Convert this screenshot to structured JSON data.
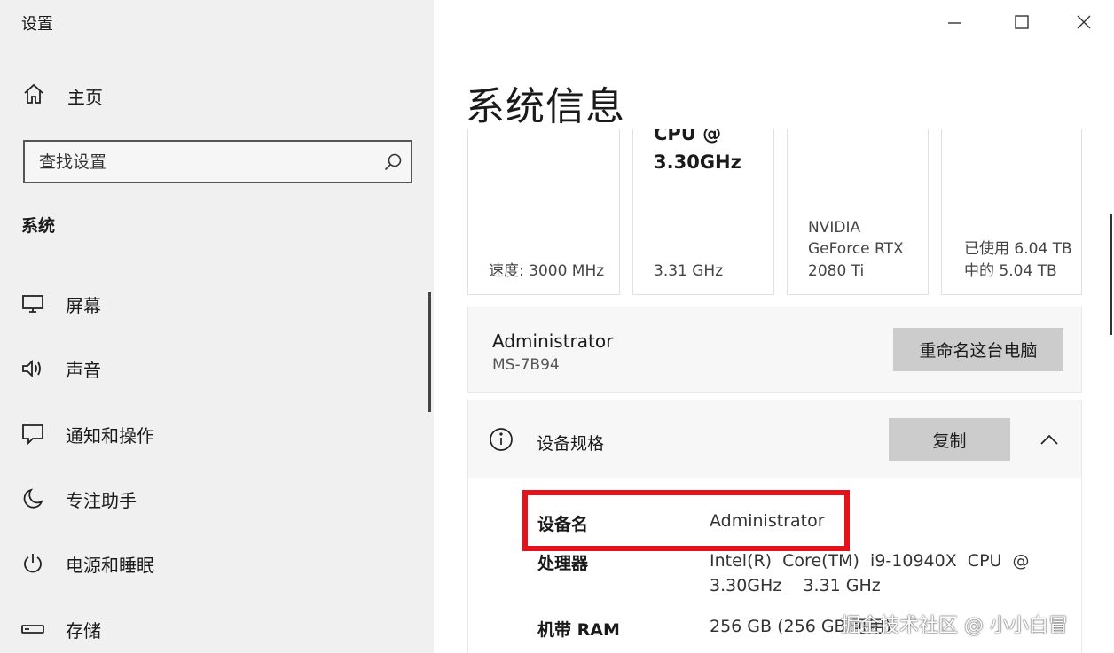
{
  "app": {
    "title": "设置"
  },
  "window_controls": {
    "minimize": "minimize-icon",
    "maximize": "maximize-icon",
    "close": "close-icon"
  },
  "sidebar": {
    "home_label": "主页",
    "search_placeholder": "查找设置",
    "section_title": "系统",
    "items": [
      {
        "label": "屏幕",
        "icon": "monitor-icon"
      },
      {
        "label": "声音",
        "icon": "speaker-icon"
      },
      {
        "label": "通知和操作",
        "icon": "notification-icon"
      },
      {
        "label": "专注助手",
        "icon": "moon-icon"
      },
      {
        "label": "电源和睡眠",
        "icon": "power-icon"
      },
      {
        "label": "存储",
        "icon": "storage-icon"
      }
    ]
  },
  "main": {
    "title": "系统信息",
    "cards": {
      "ram_speed": "速度: 3000 MHz",
      "cpu_name_tail": "CPU @",
      "cpu_name_tail2": "3.30GHz",
      "cpu_speed": "3.31 GHz",
      "gpu_line1": "NVIDIA",
      "gpu_line2": "GeForce RTX",
      "gpu_line3": "2080 Ti",
      "storage_line1": "已使用 6.04 TB",
      "storage_line2": "中的 5.04 TB"
    },
    "pc": {
      "name": "Administrator",
      "model": "MS-7B94",
      "rename_label": "重命名这台电脑"
    },
    "specs": {
      "title": "设备规格",
      "copy_label": "复制",
      "rows": [
        {
          "key": "设备名",
          "value": "Administrator"
        },
        {
          "key": "处理器",
          "value": "Intel(R)  Core(TM)  i9-10940X  CPU  @",
          "value2": "3.30GHz    3.31 GHz"
        },
        {
          "key": "机带 RAM",
          "value": "256 GB (256 GB 可用)"
        }
      ]
    }
  },
  "annotation": {
    "highlight_color": "#e3121b"
  },
  "watermark": "掘金技术社区 @ 小小白冒"
}
